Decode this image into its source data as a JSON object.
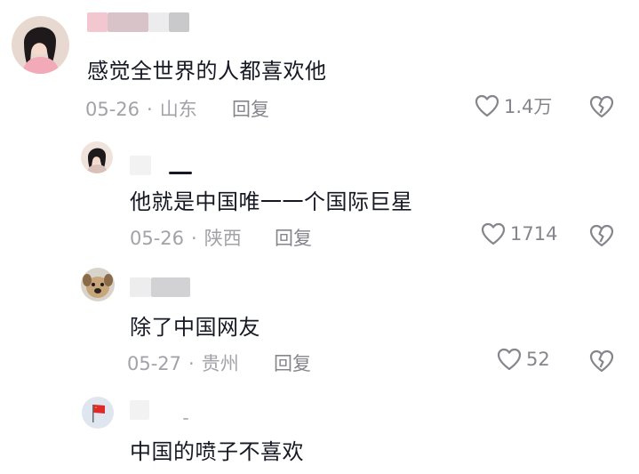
{
  "comments": [
    {
      "text": "感觉全世界的人都喜欢他",
      "date": "05-26",
      "location": "山东",
      "reply_label": "回复",
      "likes": "1.4万",
      "avatar_icon": "woman-portrait-avatar"
    },
    {
      "text": "他就是中国唯一一个国际巨星",
      "date": "05-26",
      "location": "陕西",
      "reply_label": "回复",
      "likes": "1714",
      "avatar_icon": "woman-portrait-avatar"
    },
    {
      "text": "除了中国网友",
      "date": "05-27",
      "location": "贵州",
      "reply_label": "回复",
      "likes": "52",
      "avatar_icon": "dog-avatar"
    },
    {
      "text": "中国的喷子不喜欢",
      "avatar_icon": "flag-avatar"
    }
  ],
  "colors": {
    "text": "#161823",
    "meta": "#a2a2a8",
    "icon": "#85858c",
    "blur_pink": "#f3c7cf",
    "blur_gray": "#c9c9cc"
  }
}
